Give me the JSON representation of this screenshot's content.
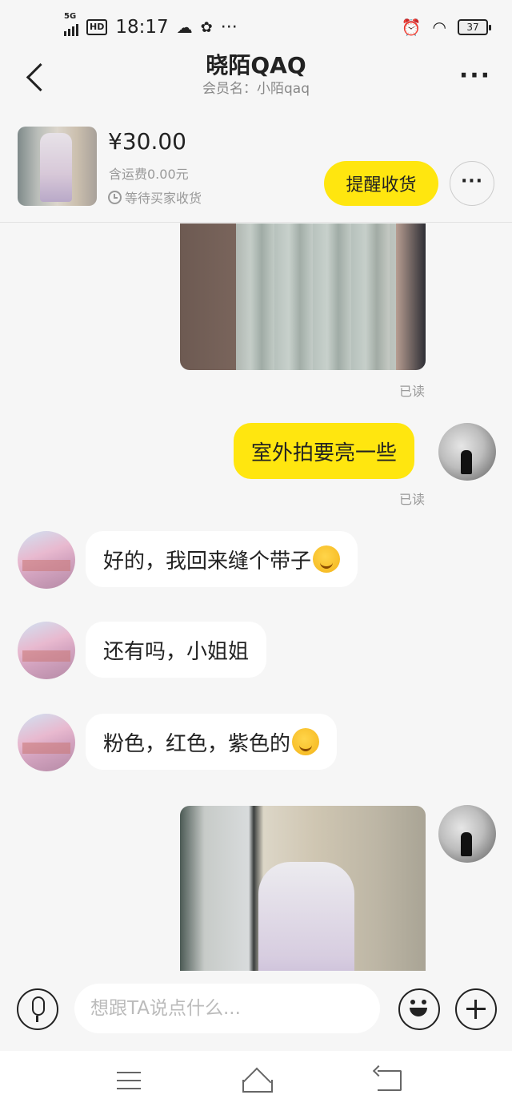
{
  "status_bar": {
    "network": "5G",
    "hd_label": "HD",
    "time": "18:17",
    "dots": "···",
    "battery": "37"
  },
  "header": {
    "title": "晓陌QAQ",
    "subtitle": "会员名：小陌qaq",
    "more": "···"
  },
  "product": {
    "price": "¥30.00",
    "shipping": "含运费0.00元",
    "status": "等待买家收货",
    "remind_button": "提醒收货",
    "more": "···"
  },
  "messages": {
    "read_1": "已读",
    "me_1": "室外拍要亮一些",
    "read_2": "已读",
    "them_1": "好的，我回来缝个带子",
    "them_2": "还有吗，小姐姐",
    "them_3": "粉色，红色，紫色的"
  },
  "input": {
    "placeholder": "想跟TA说点什么..."
  },
  "colors": {
    "accent_yellow": "#ffe60f",
    "background": "#f6f6f6",
    "bubble_other": "#ffffff"
  }
}
